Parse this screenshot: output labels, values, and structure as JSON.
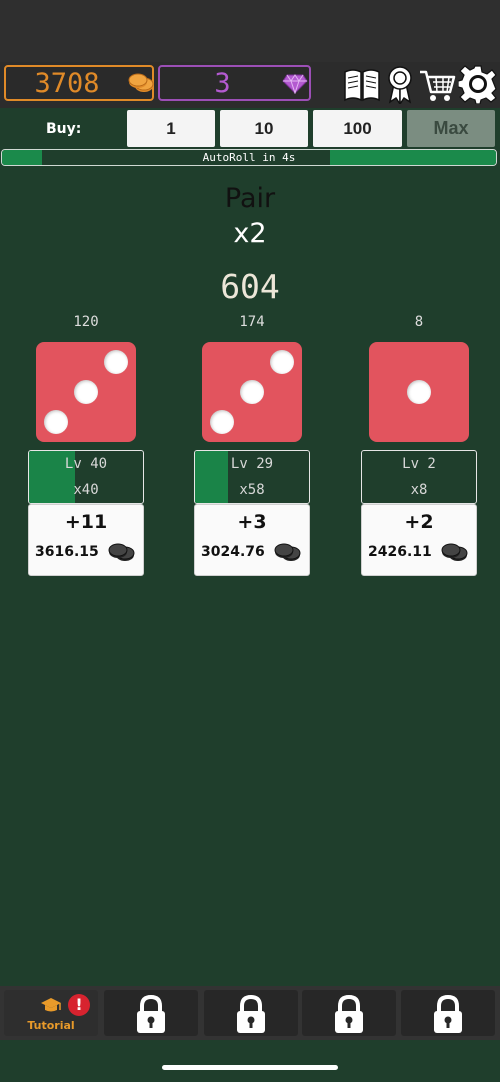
{
  "currency": {
    "coins": "3708",
    "gems": "3",
    "coin_color": "#e08a28",
    "gem_color": "#b35ad0"
  },
  "top_icons": [
    "book-icon",
    "ribbon-award-icon",
    "shopping-cart-icon",
    "gear-icon"
  ],
  "buy": {
    "label": "Buy:",
    "options": [
      "1",
      "10",
      "100",
      "Max"
    ],
    "selected": "Max"
  },
  "autoroll": {
    "text": "AutoRoll in 4s",
    "progress": 0.33
  },
  "hand": {
    "name": "Pair",
    "multiplier": "x2",
    "total": "604"
  },
  "dice": [
    {
      "value": "120",
      "face": 3,
      "level": "Lv 40",
      "multiplier": "x40",
      "level_progress": 0.4,
      "upgrade": "+11",
      "cost": "3616.15"
    },
    {
      "value": "174",
      "face": 3,
      "level": "Lv 29",
      "multiplier": "x58",
      "level_progress": 0.29,
      "upgrade": "+3",
      "cost": "3024.76"
    },
    {
      "value": "8",
      "face": 1,
      "level": "Lv 2",
      "multiplier": "x8",
      "level_progress": 0.0,
      "upgrade": "+2",
      "cost": "2426.11"
    }
  ],
  "tabs": [
    {
      "label": "Tutorial",
      "icon": "graduation-cap-icon",
      "alert": "!"
    },
    {
      "icon": "lock-icon"
    },
    {
      "icon": "lock-icon"
    },
    {
      "icon": "lock-icon"
    },
    {
      "icon": "lock-icon"
    }
  ],
  "colors": {
    "table_green": "#1f3e2c",
    "progress_green": "#1b8a4b",
    "die_red": "#e2545e"
  }
}
